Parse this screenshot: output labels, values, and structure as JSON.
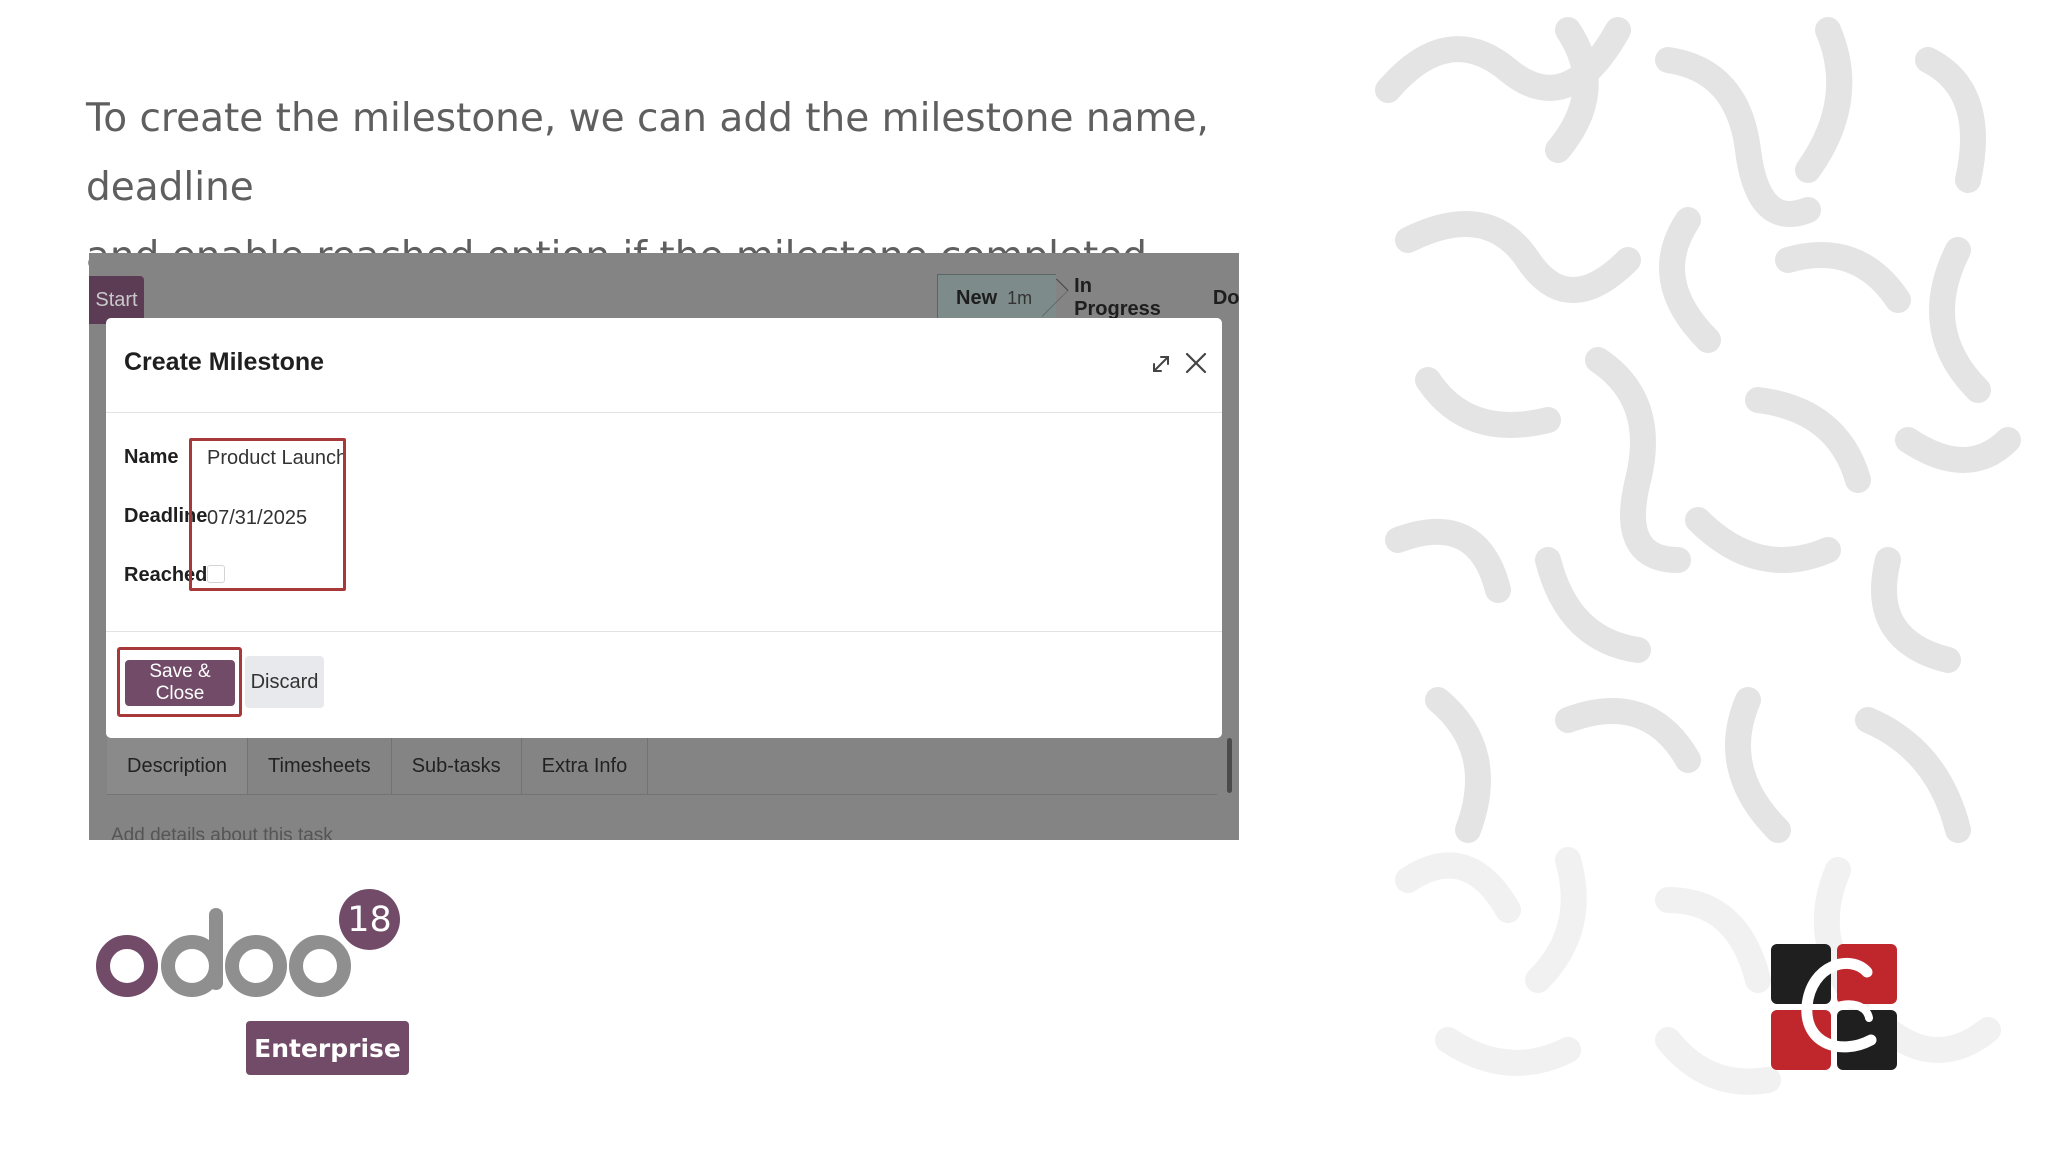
{
  "slide": {
    "intro_line1": "To create the milestone, we can add the milestone name, deadline",
    "intro_line2": "and enable reached option if the milestone completed."
  },
  "background_app": {
    "start_button": "Start",
    "stages": [
      {
        "label": "New",
        "duration": "1m"
      },
      {
        "label": "In Progress"
      },
      {
        "label": "Done"
      }
    ],
    "tabs": [
      "Description",
      "Timesheets",
      "Sub-tasks",
      "Extra Info"
    ],
    "description_placeholder": "Add details about this task"
  },
  "dialog": {
    "title": "Create Milestone",
    "fields": {
      "name_label": "Name",
      "name_value": "Product Launch",
      "deadline_label": "Deadline",
      "deadline_value": "07/31/2025",
      "reached_label": "Reached",
      "reached_checked": false
    },
    "buttons": {
      "save": "Save & Close",
      "discard": "Discard"
    },
    "icons": [
      "expand-icon",
      "close-icon"
    ]
  },
  "branding": {
    "odoo_version": "18",
    "edition": "Enterprise",
    "colors": {
      "odoo_purple": "#714b67",
      "highlight_red": "#a7393a",
      "odoo_grey": "#8f8f8f"
    }
  }
}
